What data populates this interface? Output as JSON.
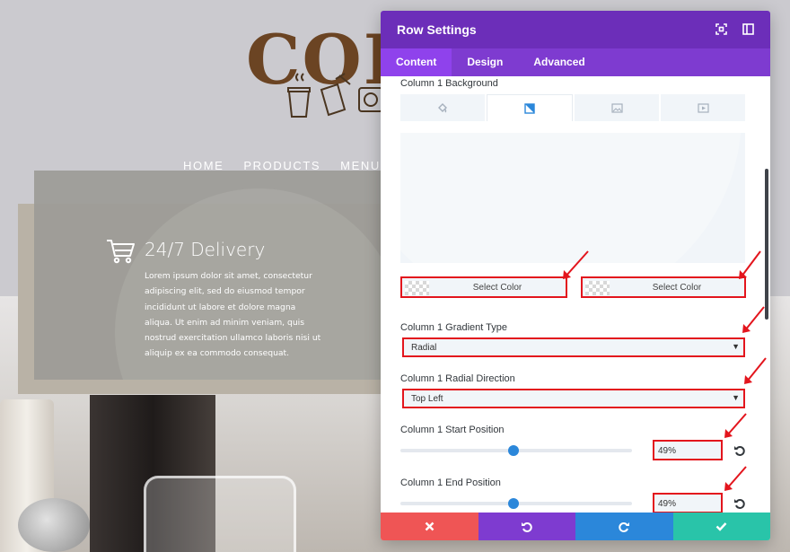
{
  "site": {
    "logo_text": "COF",
    "nav": [
      "HOME",
      "PRODUCTS",
      "MENU"
    ],
    "feature_title": "24/7 Delivery",
    "feature_body": "Lorem ipsum dolor sit amet, consectetur adipiscing elit, sed do eiusmod tempor incididunt ut labore et dolore magna aliqua. Ut enim ad minim veniam, quis nostrud exercitation ullamco laboris nisi ut aliquip ex ea commodo consequat."
  },
  "modal": {
    "title": "Row Settings",
    "tabs": [
      "Content",
      "Design",
      "Advanced"
    ],
    "active_tab": "Content",
    "background_label": "Column 1 Background",
    "background_tabs": [
      "color-icon",
      "gradient-icon",
      "image-icon",
      "video-icon"
    ],
    "active_background_tab": "gradient-icon",
    "color_pickers": [
      "Select Color",
      "Select Color"
    ],
    "gradient_type": {
      "label": "Column 1 Gradient Type",
      "value": "Radial"
    },
    "radial_direction": {
      "label": "Column 1 Radial Direction",
      "value": "Top Left"
    },
    "start_position": {
      "label": "Column 1 Start Position",
      "value": "49%",
      "level": 0.49
    },
    "end_position": {
      "label": "Column 1 End Position",
      "value": "49%",
      "level": 0.49
    },
    "footer_buttons": [
      {
        "name": "discard-button",
        "icon": "close-icon",
        "color": "#ef5555"
      },
      {
        "name": "undo-button",
        "icon": "undo-icon",
        "color": "#7e3bd0"
      },
      {
        "name": "redo-button",
        "icon": "redo-icon",
        "color": "#2b87da"
      },
      {
        "name": "save-button",
        "icon": "check-icon",
        "color": "#29c4a9"
      }
    ]
  },
  "colors": {
    "header": "#6c2eb9",
    "tabs": "#7e3bd0",
    "highlight": "#e3151d",
    "slider": "#2b87da"
  }
}
